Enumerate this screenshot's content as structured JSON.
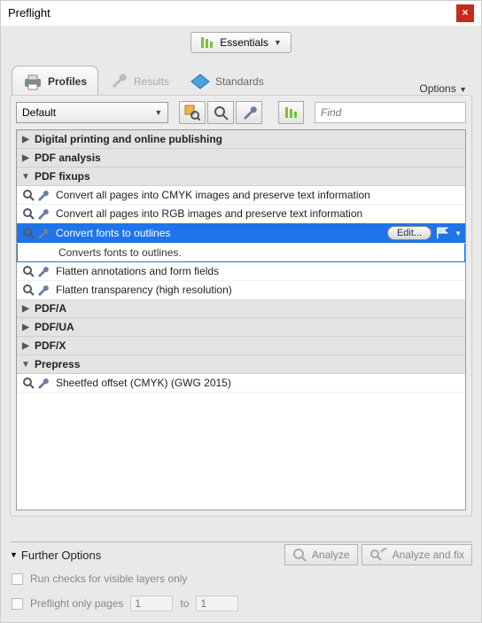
{
  "window": {
    "title": "Preflight"
  },
  "categoryButtonLabel": "Essentials",
  "tabs": {
    "profiles": "Profiles",
    "results": "Results",
    "standards": "Standards",
    "options": "Options"
  },
  "toolbar": {
    "selectValue": "Default",
    "findPlaceholder": "Find"
  },
  "groups": {
    "digital": "Digital printing and online publishing",
    "pdfanalysis": "PDF analysis",
    "pdffixups": "PDF fixups",
    "pdfa": "PDF/A",
    "pdfua": "PDF/UA",
    "pdfx": "PDF/X",
    "prepress": "Prepress"
  },
  "fixups": {
    "cmyk": "Convert all pages into CMYK images and preserve text information",
    "rgb": "Convert all pages into RGB images and preserve text information",
    "outlines": "Convert fonts to outlines",
    "outlinesDesc": "Converts fonts to outlines.",
    "editLabel": "Edit...",
    "flattenAnn": "Flatten annotations and form fields",
    "flattenTrans": "Flatten transparency (high resolution)",
    "sheetfed": "Sheetfed offset (CMYK) (GWG 2015)"
  },
  "footer": {
    "further": "Further Options",
    "analyze": "Analyze",
    "analyzeFix": "Analyze and fix",
    "runChecks": "Run checks for visible layers only",
    "prefPages": "Preflight only pages",
    "pageFrom": "1",
    "to": "to",
    "pageTo": "1"
  }
}
